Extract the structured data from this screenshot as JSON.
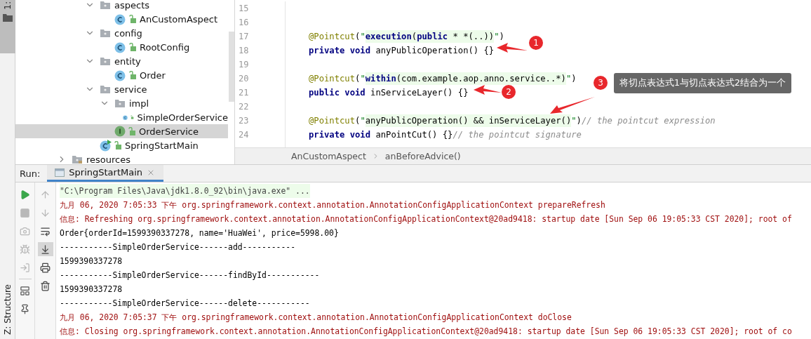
{
  "side_strip": {
    "top_label": "1:",
    "bottom_label": "Z: Structure"
  },
  "project_tree": [
    {
      "label": "aspects",
      "kind": "folder",
      "expanded": true,
      "selected": false,
      "children": [
        {
          "label": "AnCustomAspect",
          "kind": "class",
          "selected": false
        }
      ]
    },
    {
      "label": "config",
      "kind": "folder",
      "expanded": true,
      "selected": false,
      "children": [
        {
          "label": "RootConfig",
          "kind": "class",
          "selected": false
        }
      ]
    },
    {
      "label": "entity",
      "kind": "folder",
      "expanded": true,
      "selected": false,
      "children": [
        {
          "label": "Order",
          "kind": "class",
          "selected": false
        }
      ]
    },
    {
      "label": "service",
      "kind": "folder",
      "expanded": true,
      "selected": false,
      "children": [
        {
          "label": "impl",
          "kind": "folder",
          "expanded": true,
          "selected": false,
          "children": [
            {
              "label": "SimpleOrderService",
              "kind": "class",
              "selected": false
            }
          ]
        },
        {
          "label": "OrderService",
          "kind": "interface",
          "selected": true
        }
      ]
    },
    {
      "label": "SpringStartMain",
      "kind": "main_class",
      "selected": false
    }
  ],
  "project_tree_outer": [
    {
      "label": "resources",
      "kind": "resources_folder",
      "expanded": false,
      "selected": false
    }
  ],
  "editor": {
    "lines": [
      {
        "number": "15"
      },
      {
        "number": "16"
      },
      {
        "number": "17",
        "tokens": [
          {
            "kind": "annotation",
            "text": "@Pointcut"
          },
          {
            "kind": "punct",
            "text": "("
          },
          {
            "kind": "quote",
            "text": "\""
          },
          {
            "kind": "injected_keyword",
            "text": "execution"
          },
          {
            "kind": "injected",
            "text": "("
          },
          {
            "kind": "injected_keyword",
            "text": "public"
          },
          {
            "kind": "injected",
            "text": " * *(..))"
          },
          {
            "kind": "quote",
            "text": "\""
          },
          {
            "kind": "punct",
            "text": ")"
          }
        ]
      },
      {
        "number": "18",
        "tokens": [
          {
            "kind": "keyword",
            "text": "private void "
          },
          {
            "kind": "plain",
            "text": "anyPublicOperation() {}"
          }
        ]
      },
      {
        "number": "19"
      },
      {
        "number": "20",
        "tokens": [
          {
            "kind": "annotation",
            "text": "@Pointcut"
          },
          {
            "kind": "punct",
            "text": "("
          },
          {
            "kind": "quote",
            "text": "\""
          },
          {
            "kind": "injected_keyword",
            "text": "within"
          },
          {
            "kind": "injected",
            "text": "(com.example.aop.anno.service..*)"
          },
          {
            "kind": "quote",
            "text": "\""
          },
          {
            "kind": "punct",
            "text": ")"
          }
        ]
      },
      {
        "number": "21",
        "tokens": [
          {
            "kind": "keyword",
            "text": "public void "
          },
          {
            "kind": "plain",
            "text": "inServiceLayer() {}"
          }
        ]
      },
      {
        "number": "22"
      },
      {
        "number": "23",
        "tokens": [
          {
            "kind": "annotation",
            "text": "@Pointcut"
          },
          {
            "kind": "punct",
            "text": "("
          },
          {
            "kind": "quote",
            "text": "\""
          },
          {
            "kind": "injected",
            "text": "anyPublicOperation() && inServiceLayer()"
          },
          {
            "kind": "quote",
            "text": "\""
          },
          {
            "kind": "punct",
            "text": ")"
          },
          {
            "kind": "comment",
            "text": "// the pointcut expression"
          }
        ]
      },
      {
        "number": "24",
        "tokens": [
          {
            "kind": "keyword",
            "text": "private void "
          },
          {
            "kind": "plain",
            "text": "anPointCut() {}"
          },
          {
            "kind": "comment",
            "text": "// the pointcut signature"
          }
        ]
      }
    ],
    "breadcrumb": [
      "AnCustomAspect",
      "anBeforeAdvice()"
    ]
  },
  "callouts": [
    {
      "number": "1"
    },
    {
      "number": "2"
    },
    {
      "number": "3",
      "note": "将切点表达式1与切点表达式2结合为一个"
    }
  ],
  "run_panel": {
    "label": "Run:",
    "tabs": [
      {
        "label": "SpringStartMain",
        "selected": true
      }
    ],
    "toolbar_left": [
      {
        "kind": "run",
        "disabled": false
      },
      {
        "kind": "stop",
        "disabled": true
      },
      {
        "kind": "snapshot",
        "disabled": true
      },
      {
        "kind": "debug",
        "disabled": true
      },
      {
        "kind": "import",
        "disabled": true
      },
      {
        "kind": "layout",
        "disabled": false
      },
      {
        "kind": "pin",
        "disabled": false
      }
    ],
    "toolbar_right": [
      {
        "kind": "up",
        "disabled": true,
        "selected": false
      },
      {
        "kind": "down",
        "disabled": true,
        "selected": false
      },
      {
        "kind": "wrap",
        "disabled": false,
        "selected": false
      },
      {
        "kind": "scroll_end",
        "disabled": false,
        "selected": true
      },
      {
        "kind": "print",
        "disabled": false,
        "selected": false
      },
      {
        "kind": "clear",
        "disabled": false,
        "selected": false
      }
    ],
    "console": [
      {
        "kind": "command",
        "text": "\"C:\\Program Files\\Java\\jdk1.8.0_92\\bin\\java.exe\" ..."
      },
      {
        "kind": "log",
        "text": "九月 06, 2020 7:05:33 下午 org.springframework.context.annotation.AnnotationConfigApplicationContext prepareRefresh"
      },
      {
        "kind": "log",
        "text": "信息: Refreshing org.springframework.context.annotation.AnnotationConfigApplicationContext@20ad9418: startup date [Sun Sep 06 19:05:33 CST 2020]; root of"
      },
      {
        "kind": "output",
        "text": "Order{orderId=1599390337278, name='HuaWei', price=5998.00}"
      },
      {
        "kind": "output",
        "text": "-----------SimpleOrderService------add-----------"
      },
      {
        "kind": "output",
        "text": "1599390337278"
      },
      {
        "kind": "output",
        "text": "-----------SimpleOrderService------findById-----------"
      },
      {
        "kind": "output",
        "text": "1599390337278"
      },
      {
        "kind": "output",
        "text": "-----------SimpleOrderService------delete-----------"
      },
      {
        "kind": "log",
        "text": "九月 06, 2020 7:05:37 下午 org.springframework.context.annotation.AnnotationConfigApplicationContext doClose"
      },
      {
        "kind": "log",
        "text": "信息: Closing org.springframework.context.annotation.AnnotationConfigApplicationContext@20ad9418: startup date [Sun Sep 06 19:05:33 CST 2020]; root of co"
      }
    ]
  }
}
